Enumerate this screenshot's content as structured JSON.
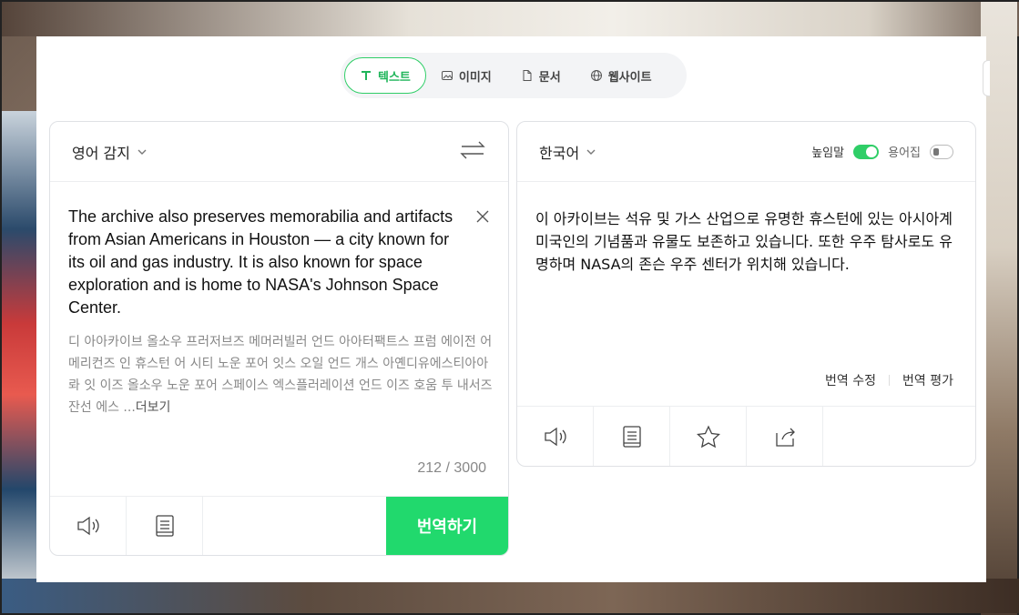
{
  "tabs": [
    {
      "label": "텍스트",
      "icon": "text-icon",
      "active": true
    },
    {
      "label": "이미지",
      "icon": "image-icon",
      "active": false
    },
    {
      "label": "문서",
      "icon": "document-icon",
      "active": false
    },
    {
      "label": "웹사이트",
      "icon": "globe-icon",
      "active": false
    }
  ],
  "source": {
    "language": "영어 감지",
    "text": "The archive also preserves memorabilia and artifacts from Asian Americans in Houston — a city known for its oil and gas industry. It is also known for space exploration and is home to NASA's Johnson Space Center.",
    "pronunciation": "디 아아카이브 올소우 프러저브즈 메머러빌러 언드 아아터팩트스 프럼 에이전 어메리컨즈 인 휴스턴 어 시티 노운 포어 잇스 오일 언드 개스 아옌디유에스티아아롸 잇 이즈 올소우 노운 포어 스페이스 엑스플러레이션 언드 이즈 호움 투 내서즈 잔선 에스 ...",
    "more_label": "더보기",
    "counter": "212 / 3000",
    "translate_button": "번역하기"
  },
  "target": {
    "language": "한국어",
    "honorific_label": "높임말",
    "honorific_on": true,
    "glossary_label": "용어집",
    "glossary_on": false,
    "text": "이 아카이브는 석유 및 가스 산업으로 유명한 휴스턴에 있는 아시아계 미국인의 기념품과 유물도 보존하고 있습니다. 또한 우주 탐사로도 유명하며 NASA의 존슨 우주 센터가 위치해 있습니다.",
    "edit_label": "번역 수정",
    "rate_label": "번역 평가"
  },
  "colors": {
    "accent": "#21d96d",
    "accent_text": "#1fb55a"
  }
}
